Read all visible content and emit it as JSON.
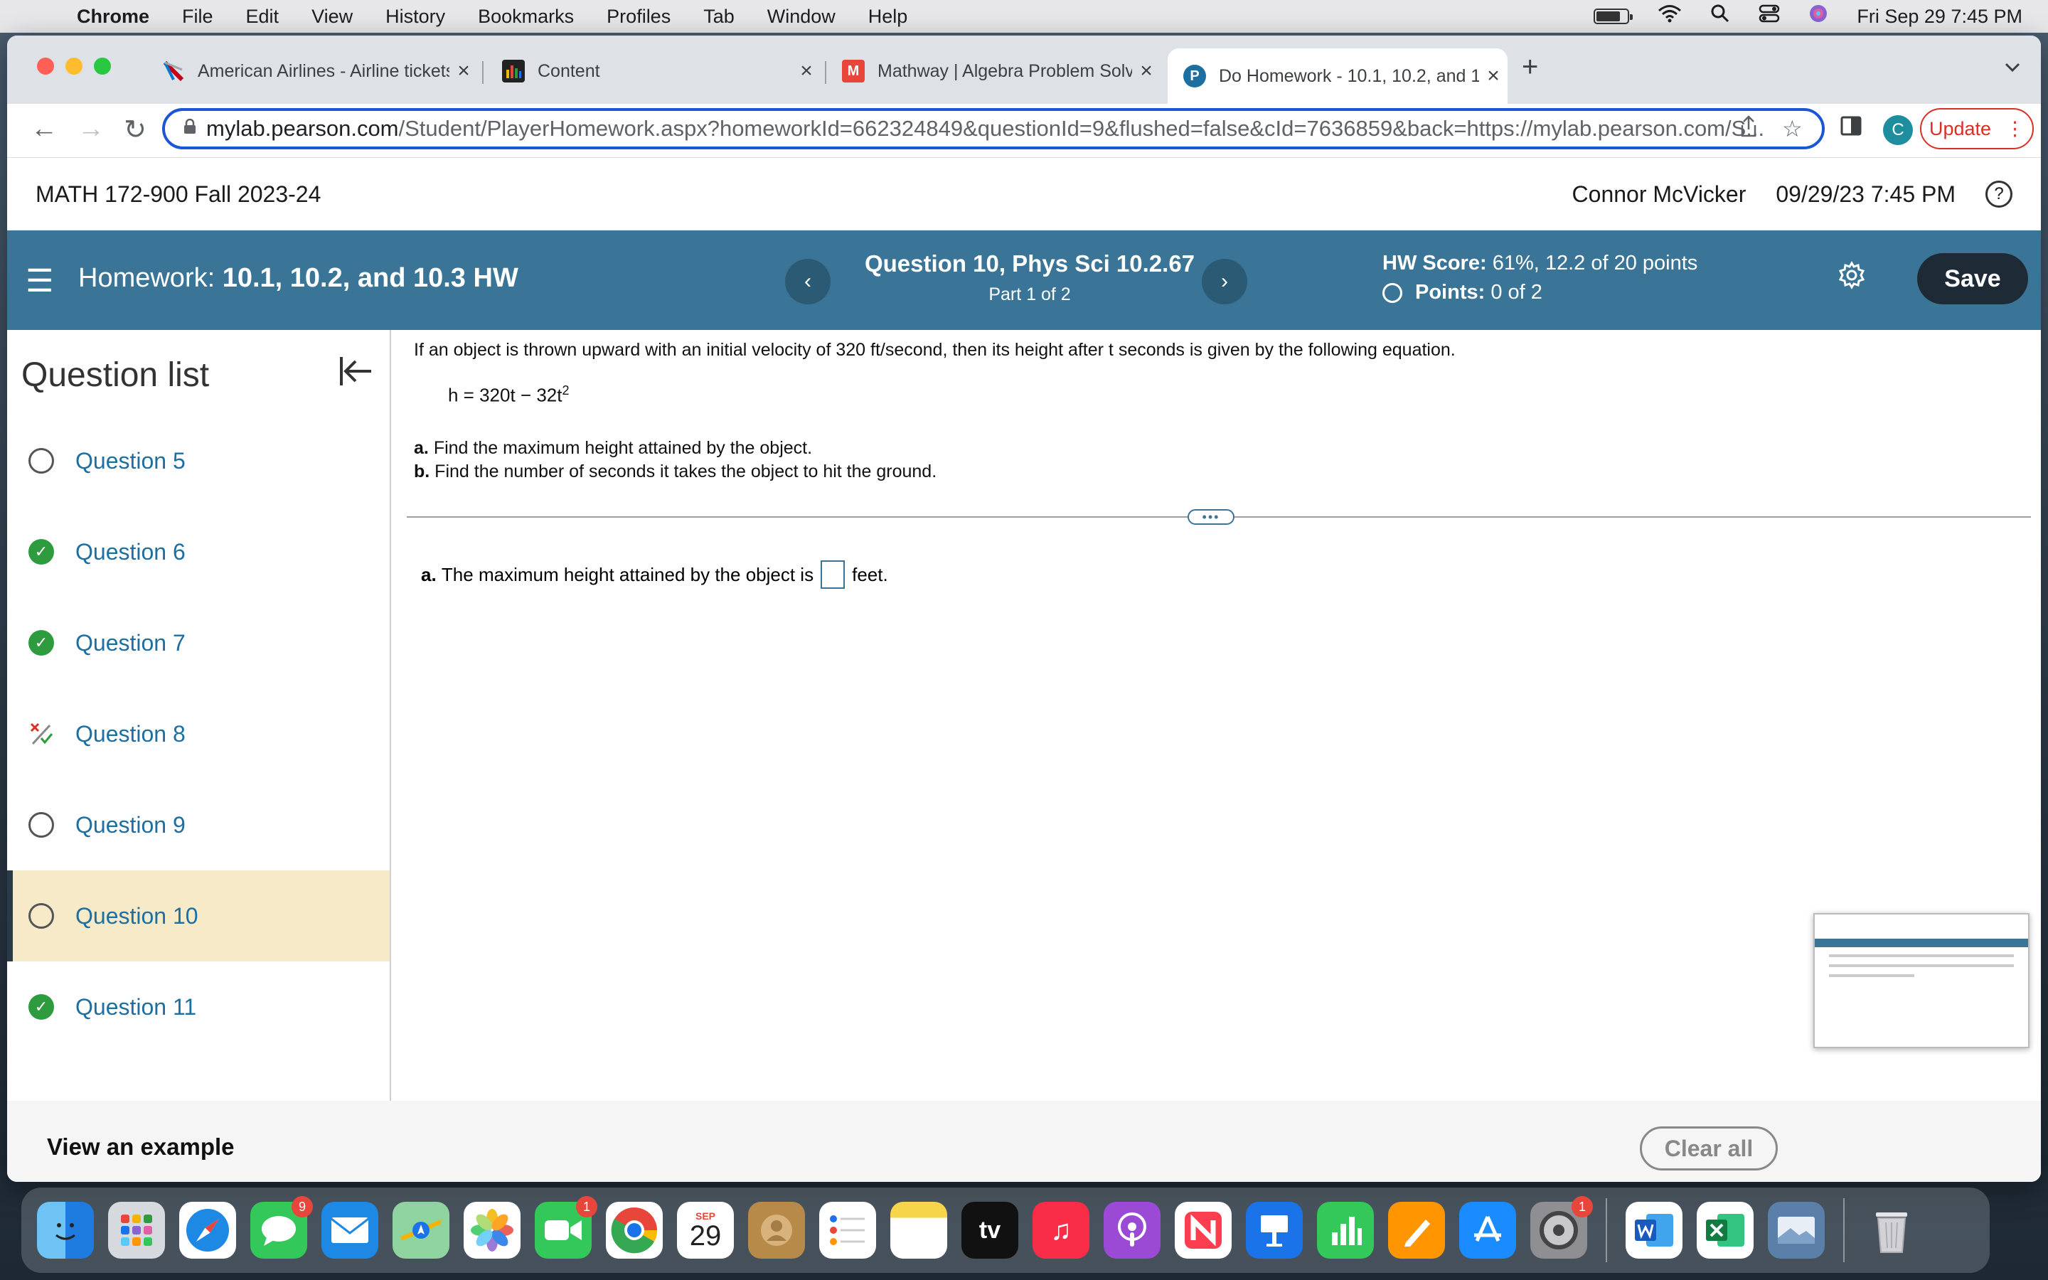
{
  "menubar": {
    "items": [
      "Chrome",
      "File",
      "Edit",
      "View",
      "History",
      "Bookmarks",
      "Profiles",
      "Tab",
      "Window",
      "Help"
    ],
    "clock": "Fri Sep 29  7:45 PM",
    "battery_level": 0.7
  },
  "tabs": [
    {
      "title": "American Airlines - Airline tickets",
      "favicon": "aa-icon"
    },
    {
      "title": "Content",
      "favicon": "bars-icon"
    },
    {
      "title": "Mathway | Algebra Problem Solver",
      "favicon": "mathway-icon",
      "favicon_text": "M"
    },
    {
      "title": "Do Homework - 10.1, 10.2, and 10.3 HW",
      "favicon": "pearson-icon",
      "favicon_text": "P"
    }
  ],
  "toolbar": {
    "url_host": "mylab.pearson.com",
    "url_path": "/Student/PlayerHomework.aspx?homeworkId=662324849&questionId=9&flushed=false&cId=7636859&back=https://mylab.pearson.com/S...",
    "profile_initial": "C",
    "update_label": "Update"
  },
  "course": {
    "name": "MATH 172-900 Fall 2023-24",
    "user": "Connor McVicker",
    "datetime": "09/29/23 7:45 PM"
  },
  "homework": {
    "label": "Homework:",
    "name": "10.1, 10.2, and 10.3 HW",
    "question_title": "Question 10, Phys Sci 10.2.67",
    "part": "Part 1 of 2",
    "score_label": "HW Score:",
    "score_value": "61%, 12.2 of 20 points",
    "points_label": "Points:",
    "points_value": "0 of 2",
    "save_label": "Save"
  },
  "sidebar": {
    "title": "Question list",
    "items": [
      {
        "label": "Question 5",
        "status": "open"
      },
      {
        "label": "Question 6",
        "status": "done"
      },
      {
        "label": "Question 7",
        "status": "done"
      },
      {
        "label": "Question 8",
        "status": "partial"
      },
      {
        "label": "Question 9",
        "status": "open"
      },
      {
        "label": "Question 10",
        "status": "current"
      },
      {
        "label": "Question 11",
        "status": "done"
      }
    ]
  },
  "problem": {
    "statement": "If an object is thrown upward with an initial velocity of 320 ft/second, then its height after t seconds is given by the following equation.",
    "equation_base": "h = 320t − 32t",
    "equation_exp": "2",
    "part_a_label": "a.",
    "part_a_text": "Find the maximum height attained by the object.",
    "part_b_label": "b.",
    "part_b_text": "Find the number of seconds it takes the object to hit the ground.",
    "answer_label": "a.",
    "answer_prefix": "The maximum height attained by the object is",
    "answer_suffix": "feet."
  },
  "footer": {
    "view_example": "View an example",
    "clear_all": "Clear all"
  },
  "dock": {
    "calendar_month": "SEP",
    "calendar_day": "29",
    "messages_badge": "9",
    "facetime_badge": "1",
    "settings_badge": "1",
    "tv_label": "tv"
  }
}
